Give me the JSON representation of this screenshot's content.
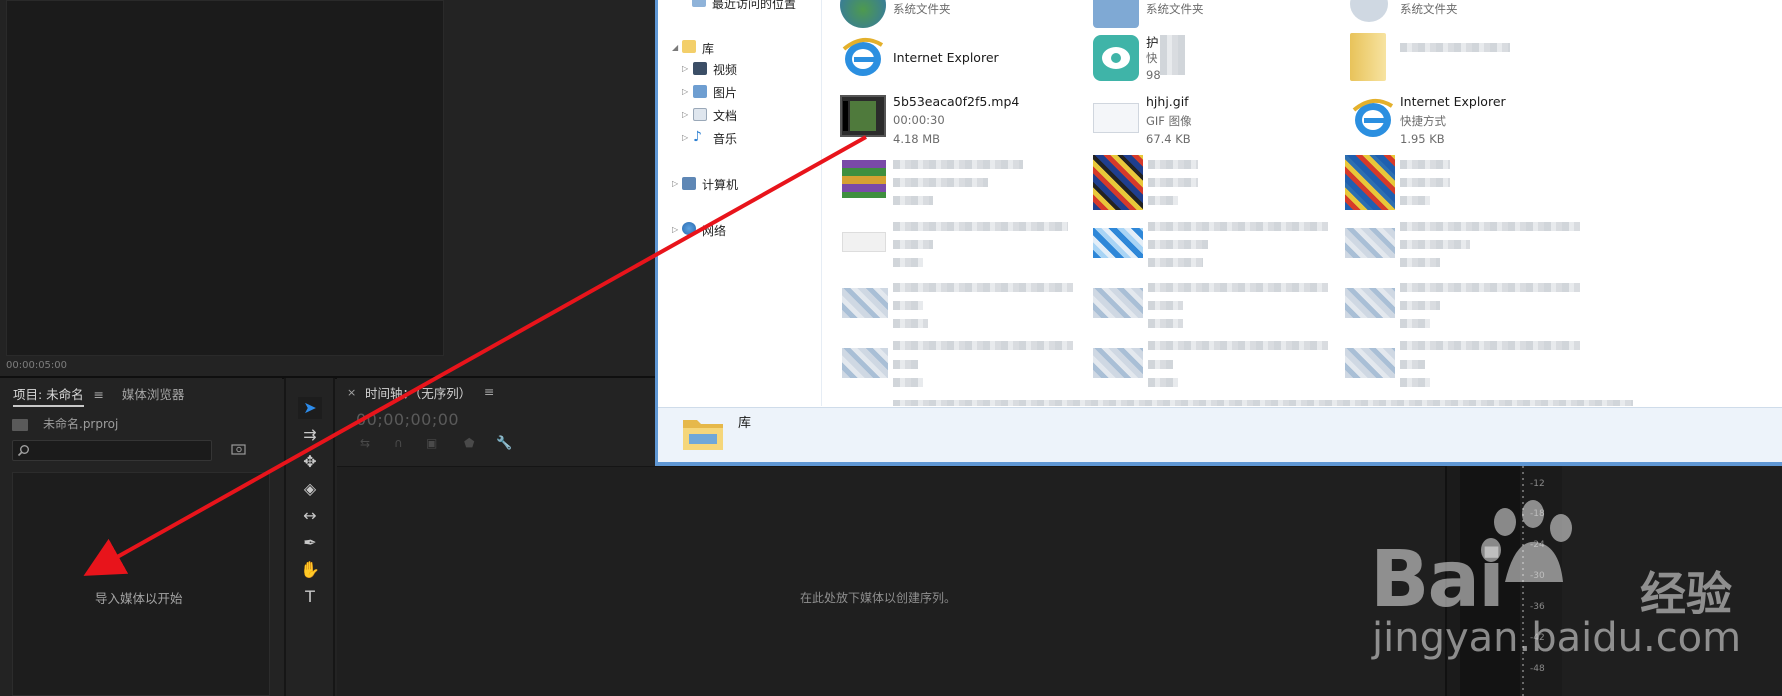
{
  "monitor": {
    "timecode": "00:00:05:00"
  },
  "project_panel": {
    "tab_project": "项目: 未命名",
    "tab_menu": "≡",
    "tab_media_browser": "媒体浏览器",
    "file_name": "未命名.prproj",
    "empty_hint": "导入媒体以开始"
  },
  "timeline_panel": {
    "close": "×",
    "tab_title": "时间轴：（无序列）",
    "tab_menu": "≡",
    "timecode": "00;00;00;00",
    "empty_hint": "在此处放下媒体以创建序列。"
  },
  "tools": [
    {
      "name": "selection-tool-icon",
      "glyph": "➤",
      "selected": true
    },
    {
      "name": "track-select-tool-icon",
      "glyph": "⇉"
    },
    {
      "name": "ripple-edit-tool-icon",
      "glyph": "✥"
    },
    {
      "name": "razor-tool-icon",
      "glyph": "◈"
    },
    {
      "name": "slip-tool-icon",
      "glyph": "↔"
    },
    {
      "name": "pen-tool-icon",
      "glyph": "✒"
    },
    {
      "name": "hand-tool-icon",
      "glyph": "✋"
    },
    {
      "name": "type-tool-icon",
      "glyph": "T"
    }
  ],
  "meter_labels": [
    "-12",
    "-18",
    "-24",
    "-30",
    "-36",
    "-42",
    "-48"
  ],
  "explorer": {
    "nav": {
      "recent": "最近访问的位置",
      "library": "库",
      "videos": "视频",
      "pictures": "图片",
      "documents": "文档",
      "music": "音乐",
      "computer": "计算机",
      "network": "网络"
    },
    "files": {
      "row0_a_sub": "系统文件夹",
      "row0_b_sub": "系统文件夹",
      "row0_c_sub": "系统文件夹",
      "ie1_name": "Internet Explorer",
      "app2_name": "护",
      "app2_sub1": "快",
      "app2_sub2": "98",
      "mp4_name": "5b53eaca0f2f5.mp4",
      "mp4_duration": "00:00:30",
      "mp4_size": "4.18 MB",
      "gif_name": "hjhj.gif",
      "gif_type": "GIF 图像",
      "gif_size": "67.4 KB",
      "ie2_name": "Internet Explorer",
      "ie2_type": "快捷方式",
      "ie2_size": "1.95 KB"
    },
    "details_name": "库"
  },
  "watermark": {
    "logo": "Bai",
    "cn": "经验",
    "url": "jingyan.baidu.com"
  },
  "colors": {
    "arrow": "#e8141b",
    "selection_blue": "#2d8ceb",
    "window_border": "#5f97d4"
  }
}
